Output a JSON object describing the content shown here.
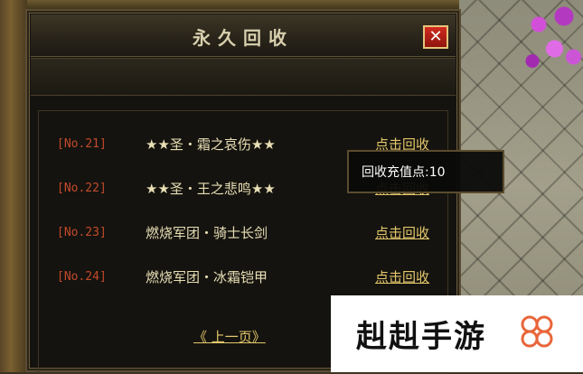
{
  "window": {
    "title": "永久回收",
    "close_icon": "close-icon"
  },
  "items": [
    {
      "no": "[No.21]",
      "name": "★★圣・霜之哀伤★★",
      "action": "点击回收"
    },
    {
      "no": "[No.22]",
      "name": "★★圣・王之悲鸣★★",
      "action": "点击回收"
    },
    {
      "no": "[No.23]",
      "name": "燃烧军团・骑士长剑",
      "action": "点击回收"
    },
    {
      "no": "[No.24]",
      "name": "燃烧军团・冰霜铠甲",
      "action": "点击回收"
    }
  ],
  "tooltip": {
    "text": "回收充值点:10"
  },
  "pagination": {
    "prev_label": "《 上一页》"
  },
  "watermark": {
    "text": "赳赳手游",
    "icon": "clover-logo-icon"
  },
  "colors": {
    "accent_gold": "#e3c76b",
    "number_red": "#c24a2b",
    "item_text": "#e8dfb5",
    "close_red": "#d02a1e"
  }
}
